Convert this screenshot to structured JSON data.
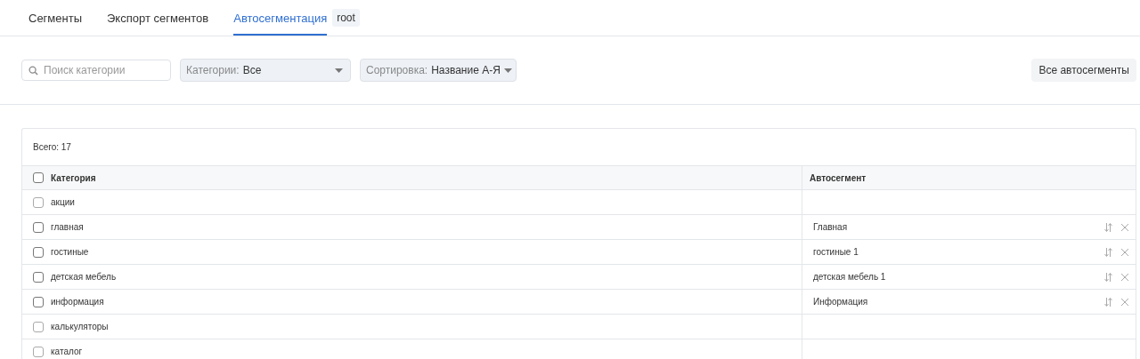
{
  "tabs": [
    {
      "label": "Сегменты",
      "selected": false
    },
    {
      "label": "Экспорт сегментов",
      "selected": false
    },
    {
      "label": "Автосегментация",
      "selected": true
    }
  ],
  "tab_badge": "root",
  "search": {
    "placeholder": "Поиск категории"
  },
  "filters": [
    {
      "label": "Категории:",
      "value": "Все"
    },
    {
      "label": "Сортировка:",
      "value": "Название А-Я"
    }
  ],
  "all_button": "Все автосегменты",
  "total": "Всего: 17",
  "table": {
    "columns": [
      {
        "label": "Категория",
        "checked": false
      },
      {
        "label": "Автосегмент"
      }
    ],
    "rows": [
      {
        "category": "акции",
        "checked": false
      },
      {
        "category": "главная",
        "checked": false,
        "autosegment": "Главная"
      },
      {
        "category": "гостиные",
        "checked": false,
        "autosegment": "гостиные 1"
      },
      {
        "category": "детская мебель",
        "checked": false,
        "autosegment": "детская мебель 1"
      },
      {
        "category": "информация",
        "checked": false,
        "autosegment": "Информация"
      },
      {
        "category": "калькуляторы",
        "checked": false
      },
      {
        "category": "каталог",
        "checked": false
      }
    ]
  }
}
